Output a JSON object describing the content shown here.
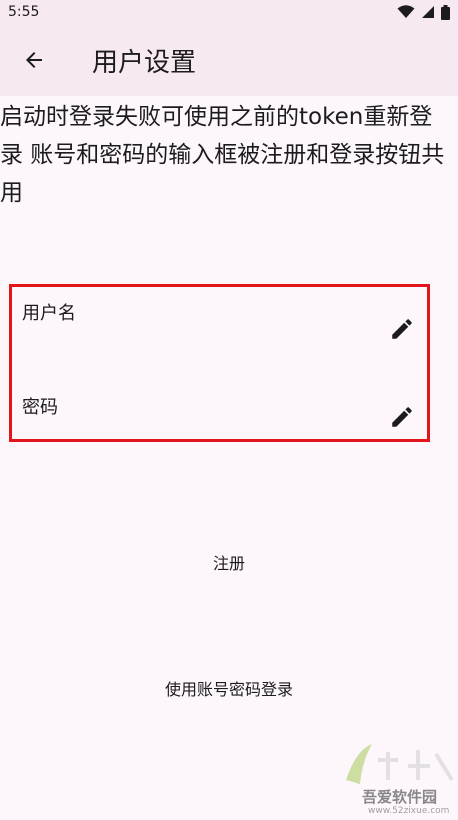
{
  "status_bar": {
    "time": "5:55",
    "icons": [
      "wifi-icon",
      "signal-icon",
      "battery-icon"
    ]
  },
  "app_bar": {
    "back_icon": "arrow-left-icon",
    "title": "用户设置"
  },
  "description": "启动时登录失败可使用之前的token重新登录 账号和密码的输入框被注册和登录按钮共用",
  "form": {
    "username_label": "用户名",
    "password_label": "密码",
    "edit_icon": "pencil-icon",
    "border_color": "#e3151c"
  },
  "buttons": {
    "register": "注册",
    "login": "使用账号密码登录"
  },
  "watermark": {
    "brand": "吾爱软件园",
    "url": "www.52zixue.com"
  }
}
